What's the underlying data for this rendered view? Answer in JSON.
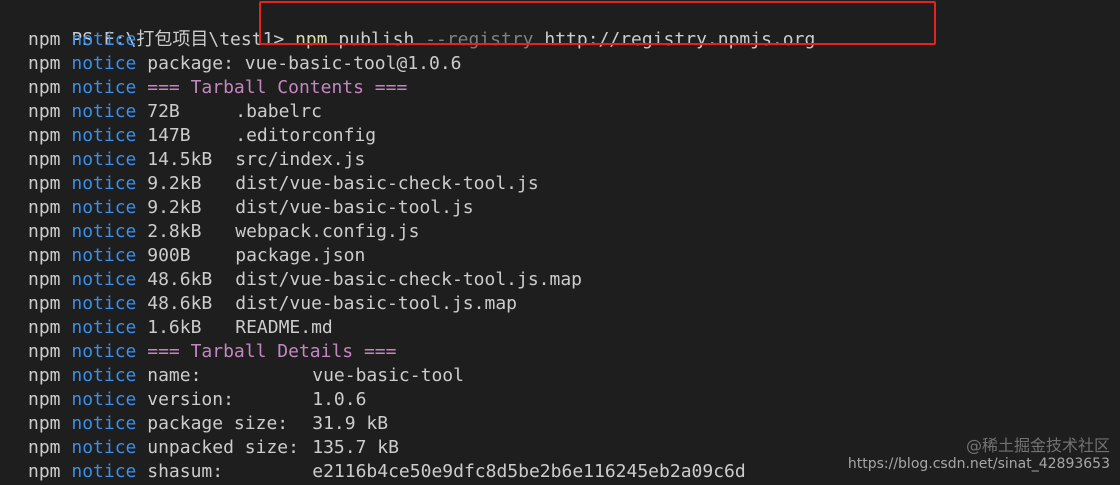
{
  "terminal": {
    "prompt": "PS E:\\打包项目\\test1> ",
    "command": {
      "npm": "npm",
      "sub": " publish ",
      "flag": "--registry",
      "url": " http://registry.npmjs.org"
    },
    "lines": [
      {
        "kind": "plain",
        "text": ""
      },
      {
        "kind": "plain",
        "text": "package: vue-basic-tool@1.0.6"
      },
      {
        "kind": "header",
        "text": "=== Tarball Contents ==="
      },
      {
        "kind": "file",
        "size": "72B",
        "name": ".babelrc"
      },
      {
        "kind": "file",
        "size": "147B",
        "name": ".editorconfig"
      },
      {
        "kind": "file",
        "size": "14.5kB",
        "name": "src/index.js"
      },
      {
        "kind": "file",
        "size": "9.2kB",
        "name": "dist/vue-basic-check-tool.js"
      },
      {
        "kind": "file",
        "size": "9.2kB",
        "name": "dist/vue-basic-tool.js"
      },
      {
        "kind": "file",
        "size": "2.8kB",
        "name": "webpack.config.js"
      },
      {
        "kind": "file",
        "size": "900B",
        "name": "package.json"
      },
      {
        "kind": "file",
        "size": "48.6kB",
        "name": "dist/vue-basic-check-tool.js.map"
      },
      {
        "kind": "file",
        "size": "48.6kB",
        "name": "dist/vue-basic-tool.js.map"
      },
      {
        "kind": "file",
        "size": "1.6kB",
        "name": "README.md"
      },
      {
        "kind": "header",
        "text": "=== Tarball Details ==="
      },
      {
        "kind": "kv",
        "key": "name:",
        "value": "vue-basic-tool"
      },
      {
        "kind": "kv",
        "key": "version:",
        "value": "1.0.6"
      },
      {
        "kind": "kv",
        "key": "package size:",
        "value": "31.9 kB"
      },
      {
        "kind": "kv",
        "key": "unpacked size:",
        "value": "135.7 kB"
      },
      {
        "kind": "kv",
        "key": "shasum:",
        "value": "e2116b4ce50e9dfc8d5be2b6e116245eb2a09c6d"
      }
    ],
    "npm_label": "npm",
    "notice_label": "notice"
  },
  "watermark": {
    "line1": "@稀土掘金技术社区",
    "line2": "https://blog.csdn.net/sinat_42893653"
  },
  "colors": {
    "background": "#1e1e1e",
    "text": "#cccccc",
    "notice": "#3b8eea",
    "header": "#c586c0",
    "npm_cmd": "#dcdcaa",
    "highlight": "#e52222"
  }
}
